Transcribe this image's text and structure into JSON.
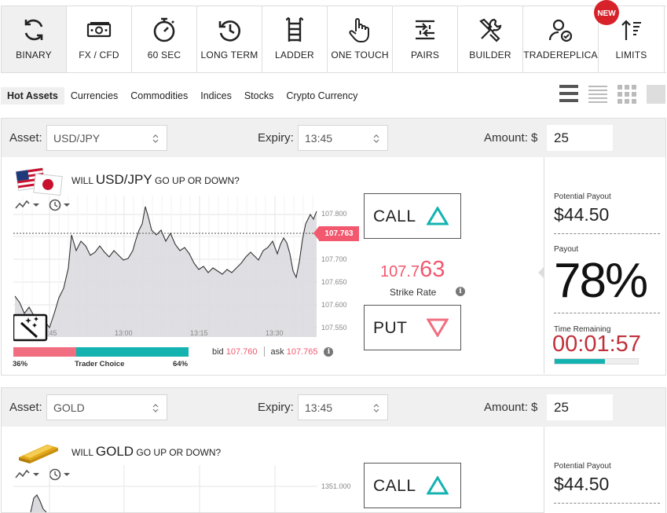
{
  "toolbar": {
    "items": [
      {
        "label": "BINARY",
        "icon": "refresh-icon"
      },
      {
        "label": "FX / CFD",
        "icon": "cash-icon"
      },
      {
        "label": "60 SEC",
        "icon": "stopwatch-icon"
      },
      {
        "label": "LONG TERM",
        "icon": "history-clock-icon"
      },
      {
        "label": "LADDER",
        "icon": "ladder-icon"
      },
      {
        "label": "ONE TOUCH",
        "icon": "hand-pointer-icon"
      },
      {
        "label": "PAIRS",
        "icon": "pairs-arrows-icon"
      },
      {
        "label": "BUILDER",
        "icon": "tools-icon"
      },
      {
        "label": "TRADEREPLICA",
        "icon": "user-check-icon"
      },
      {
        "label": "LIMITS",
        "icon": "sort-arrow-icon"
      }
    ],
    "new_badge": "NEW"
  },
  "tabs": [
    "Hot Assets",
    "Currencies",
    "Commodities",
    "Indices",
    "Stocks",
    "Crypto Currency"
  ],
  "panels": [
    {
      "asset_label": "Asset:",
      "asset_value": "USD/JPY",
      "expiry_label": "Expiry:",
      "expiry_value": "13:45",
      "amount_label": "Amount: $",
      "amount_value": "25",
      "question_pre": "WILL ",
      "question_asset": "USD/JPY",
      "question_post": " GO UP OR DOWN?",
      "price_tag": "107.763",
      "y_ticks": [
        "107.800",
        "107.750",
        "107.700",
        "107.650",
        "107.600",
        "107.550"
      ],
      "x_ticks": [
        "12:45",
        "13:00",
        "13:15",
        "13:30"
      ],
      "sentiment_put_pct": 36,
      "sentiment_call_pct": 64,
      "sentiment_left": "36%",
      "sentiment_mid": "Trader Choice",
      "sentiment_right": "64%",
      "bid_label": "bid",
      "bid_value": "107.760",
      "ask_label": "ask",
      "ask_value": "107.765",
      "call_label": "CALL",
      "put_label": "PUT",
      "strike_small": "107.7",
      "strike_big": "63",
      "strike_label": "Strike Rate",
      "potential_payout_label": "Potential Payout",
      "potential_payout_value": "$44.50",
      "payout_label": "Payout",
      "payout_pct": "78%",
      "time_remaining_label": "Time Remaining",
      "time_remaining_value": "00:01:57",
      "time_progress": 0.6
    },
    {
      "asset_label": "Asset:",
      "asset_value": "GOLD",
      "expiry_label": "Expiry:",
      "expiry_value": "13:45",
      "amount_label": "Amount: $",
      "amount_value": "25",
      "question_pre": "WILL ",
      "question_asset": "GOLD",
      "question_post": " GO UP OR DOWN?",
      "y_ticks": [
        "1351.000"
      ],
      "call_label": "CALL",
      "potential_payout_label": "Potential Payout",
      "potential_payout_value": "$44.50"
    }
  ],
  "colors": {
    "accent_teal": "#14b3b0",
    "accent_pink": "#f2586e",
    "timer_red": "#c0303a",
    "badge_red": "#d8222a"
  }
}
